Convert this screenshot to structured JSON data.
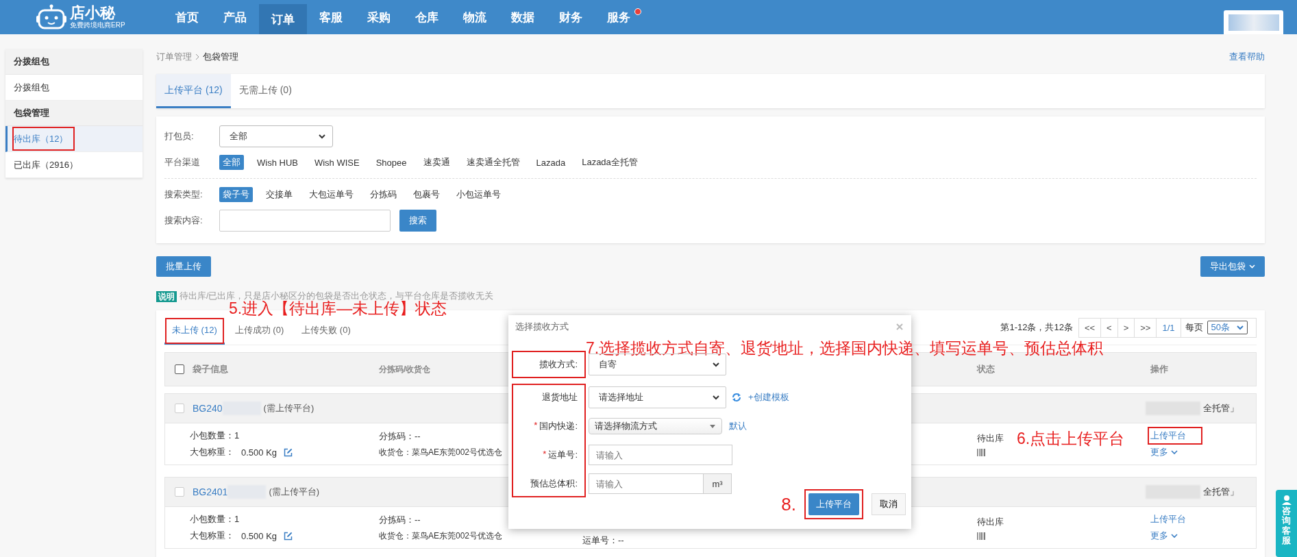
{
  "nav": {
    "logo_text": "店小秘",
    "logo_subtitle": "免费跨境电商ERP",
    "items": [
      {
        "label": "首页",
        "selected": false,
        "badge": false
      },
      {
        "label": "产品",
        "selected": false,
        "badge": false
      },
      {
        "label": "订单",
        "selected": true,
        "badge": false
      },
      {
        "label": "客服",
        "selected": false,
        "badge": false
      },
      {
        "label": "采购",
        "selected": false,
        "badge": false
      },
      {
        "label": "仓库",
        "selected": false,
        "badge": false
      },
      {
        "label": "物流",
        "selected": false,
        "badge": false
      },
      {
        "label": "数据",
        "selected": false,
        "badge": false
      },
      {
        "label": "财务",
        "selected": false,
        "badge": false
      },
      {
        "label": "服务",
        "selected": false,
        "badge": true
      }
    ]
  },
  "sidebar": {
    "sections": [
      {
        "title": "分拨组包",
        "items": [
          {
            "label": "分拨组包",
            "selected": false,
            "highlighted": false
          }
        ]
      },
      {
        "title": "包袋管理",
        "items": [
          {
            "label": "待出库（12）",
            "selected": true,
            "highlighted": true
          },
          {
            "label": "已出库（2916）",
            "selected": false,
            "highlighted": false
          }
        ]
      }
    ]
  },
  "breadcrumb": {
    "parent": "订单管理",
    "current": "包袋管理"
  },
  "help_link": "查看帮助",
  "top_tabs": [
    {
      "label": "上传平台 (12)",
      "selected": true
    },
    {
      "label": "无需上传 (0)",
      "selected": false
    }
  ],
  "filters": {
    "packer": {
      "label": "打包员:",
      "value": "全部"
    },
    "channel": {
      "label": "平台渠道",
      "options": [
        {
          "label": "全部",
          "selected": true
        },
        {
          "label": "Wish HUB",
          "selected": false
        },
        {
          "label": "Wish WISE",
          "selected": false
        },
        {
          "label": "Shopee",
          "selected": false
        },
        {
          "label": "速卖通",
          "selected": false
        },
        {
          "label": "速卖通全托管",
          "selected": false
        },
        {
          "label": "Lazada",
          "selected": false
        },
        {
          "label": "Lazada全托管",
          "selected": false
        }
      ]
    },
    "search_type": {
      "label": "搜索类型:",
      "options": [
        {
          "label": "袋子号",
          "selected": true
        },
        {
          "label": "交接单",
          "selected": false
        },
        {
          "label": "大包运单号",
          "selected": false
        },
        {
          "label": "分拣码",
          "selected": false
        },
        {
          "label": "包裹号",
          "selected": false
        },
        {
          "label": "小包运单号",
          "selected": false
        }
      ]
    },
    "search": {
      "label": "搜索内容:",
      "button": "搜索"
    }
  },
  "batch_upload_button": "批量上传",
  "export_button": "导出包袋",
  "note": {
    "badge": "说明",
    "text": "待出库/已出库，只是店小秘区分的包袋是否出仓状态，与平台仓库是否揽收无关"
  },
  "status_tabs": [
    {
      "label": "未上传 (12)",
      "selected": true,
      "highlighted": true
    },
    {
      "label": "上传成功 (0)",
      "selected": false,
      "highlighted": false
    },
    {
      "label": "上传失败 (0)",
      "selected": false,
      "highlighted": false
    }
  ],
  "status_tabs_note": "5.进入【待出库—未上传】状态",
  "pagination": {
    "summary": "第1-12条，共12条",
    "buttons": [
      "<<",
      "<",
      ">",
      ">>",
      "1/1"
    ],
    "per_page_label": "每页",
    "per_page_value": "50条"
  },
  "table": {
    "columns": [
      "袋子信息",
      "分拣码/收货仓",
      "状态",
      "操作"
    ],
    "all_checked": false,
    "rows": [
      {
        "checked": false,
        "bag_no": "BG240",
        "tag": "(需上传平台)",
        "right_tag": "全托管」",
        "count": "小包数量：1",
        "weight_label": "大包称重：",
        "weight": "0.500 Kg",
        "sort_code": "分拣码：--",
        "warehouse": "收货仓：菜鸟AE东莞002号优选仓",
        "status": "待出库",
        "action": "上传平台",
        "action_highlighted": true,
        "action_note": "6.点击上传平台",
        "more": "更多"
      },
      {
        "checked": false,
        "bag_no": "BG2401",
        "tag": "(需上传平台)",
        "right_tag": "全托管」",
        "count": "小包数量：1",
        "weight_label": "大包称重：",
        "weight": "0.500 Kg",
        "sort_code": "分拣码：--",
        "warehouse": "收货仓：菜鸟AE东莞002号优选仓",
        "waybill": "运单号：--",
        "status": "待出库",
        "action": "上传平台",
        "action_highlighted": false,
        "more": "更多"
      }
    ]
  },
  "dialog": {
    "title": "选择揽收方式",
    "note": "7.选择揽收方式自寄、退货地址，选择国内快递、填写运单号、预估总体积",
    "field_groups": [
      {
        "highlighted": true,
        "fields": [
          {
            "kind": "select",
            "label": "揽收方式:",
            "value": "自寄"
          }
        ]
      },
      {
        "highlighted": true,
        "fields": [
          {
            "kind": "select",
            "label": "退货地址",
            "value": "请选择地址",
            "refresh": true,
            "extra_link": "+创建模板"
          },
          {
            "kind": "dropdown",
            "label": "国内快递:",
            "required_mark": "*",
            "value": "请选择物流方式",
            "extra_link": "默认"
          },
          {
            "kind": "input",
            "label": "运单号:",
            "required_mark": "*",
            "placeholder": "请输入"
          },
          {
            "kind": "input",
            "label": "预估总体积:",
            "placeholder": "请输入",
            "unit": "m³"
          }
        ]
      }
    ],
    "confirm_note": "8.",
    "confirm": "上传平台",
    "confirm_highlighted": true,
    "cancel": "取消"
  },
  "support_tab": "咨询客服"
}
